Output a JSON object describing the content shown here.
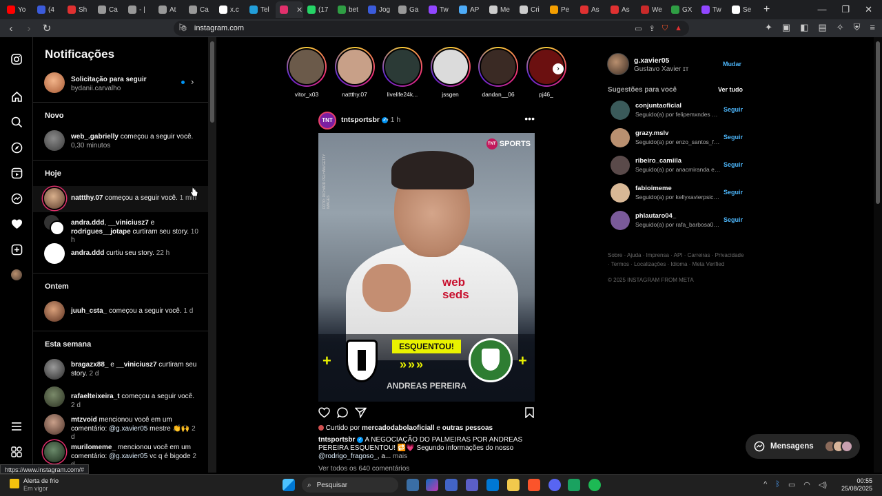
{
  "browser": {
    "tabs": [
      {
        "label": "Yo",
        "color": "#ff0000"
      },
      {
        "label": "(4",
        "color": "#3b5bdb"
      },
      {
        "label": "Sh",
        "color": "#e03131"
      },
      {
        "label": "Ca",
        "color": "#999999"
      },
      {
        "label": "- |",
        "color": "#999999"
      },
      {
        "label": "At",
        "color": "#999999"
      },
      {
        "label": "Ca",
        "color": "#999999"
      },
      {
        "label": "x.c",
        "color": "#ffffff"
      },
      {
        "label": "Tel",
        "color": "#229ed9"
      },
      {
        "label": "",
        "color": "#e1306c"
      },
      {
        "label": "(17",
        "color": "#25d366"
      },
      {
        "label": "bet",
        "color": "#2f9e44"
      },
      {
        "label": "Jog",
        "color": "#3b5bdb"
      },
      {
        "label": "Ga",
        "color": "#999999"
      },
      {
        "label": "Tw",
        "color": "#9146ff"
      },
      {
        "label": "AP",
        "color": "#4dabf7"
      },
      {
        "label": "Me",
        "color": "#cccccc"
      },
      {
        "label": "Cri",
        "color": "#cccccc"
      },
      {
        "label": "Pe",
        "color": "#f59f00"
      },
      {
        "label": "As",
        "color": "#e03131"
      },
      {
        "label": "As",
        "color": "#e03131"
      },
      {
        "label": "We",
        "color": "#c92a2a"
      },
      {
        "label": "GX",
        "color": "#2f9e44"
      },
      {
        "label": "Tw",
        "color": "#9146ff"
      },
      {
        "label": "Se",
        "color": "#ffffff"
      }
    ],
    "url": "instagram.com",
    "status_url": "https://www.instagram.com/#"
  },
  "notifications": {
    "title": "Notificações",
    "follow_request": {
      "title": "Solicitação para seguir",
      "user": "bydanii.carvalho"
    },
    "sections": {
      "novo": "Novo",
      "hoje": "Hoje",
      "ontem": "Ontem",
      "semana": "Esta semana"
    },
    "items": [
      {
        "user": "web_.gabrielly",
        "text": " começou a seguir você.",
        "time": " 0,30 minutos"
      },
      {
        "user": "nattthy.07",
        "text": " começou a seguir você.",
        "time": " 1 min"
      },
      {
        "user": "andra.ddd",
        "user2": "__viniciusz7",
        "user3": "rodrigues__jotape",
        "text": " curtiram seu story.",
        "time": " 10 h",
        "joiner": ", ",
        "joiner2": " e "
      },
      {
        "user": "andra.ddd",
        "text": " curtiu seu story.",
        "time": " 22 h"
      },
      {
        "user": "juuh_csta_",
        "text": " começou a seguir você.",
        "time": " 1 d"
      },
      {
        "user": "bragazx88_",
        "user2": "__viniciusz7",
        "text": " curtiram seu story.",
        "time": " 2 d",
        "joiner": " e "
      },
      {
        "user": "rafaelteixeira_t",
        "text": " começou a seguir você.",
        "time": " 2 d"
      },
      {
        "user": "mtzvoid",
        "text": " mencionou você em um comentário: ",
        "mention": "@g.xavier05",
        "text2": " mestre 👏🙌",
        "time": " 2 d"
      },
      {
        "user": "murilomeme_",
        "text": " mencionou você em um comentário: ",
        "mention": "@g.xavier05",
        "text2": " vc q é bigode",
        "time": " 2 d"
      }
    ]
  },
  "stories": [
    {
      "name": "vitor_x03",
      "color": "#6b5a4a"
    },
    {
      "name": "nattthy.07",
      "color": "#c8a088"
    },
    {
      "name": "livelife24k...",
      "color": "#2b3a36"
    },
    {
      "name": "jssgen",
      "color": "#dbdbdb"
    },
    {
      "name": "dandan__06",
      "color": "#3a2a24"
    },
    {
      "name": "pj46_",
      "color": "#6b1010"
    }
  ],
  "post": {
    "avatar_text": "TNT",
    "user": "tntsportsbr",
    "time": "• 1 h",
    "brand": "SPORTS",
    "sponsor_line1": "web",
    "sponsor_line2": "seds",
    "banner": "ESQUENTOU!",
    "arrows": "»»»",
    "plus": "+",
    "player": "ANDREAS PEREIRA",
    "side_credit": "FOTO: RICHARD PELHAM/GETTY IMAGES",
    "liked_prefix": "Curtido por ",
    "liked_user": "mercadodabolaoficiall",
    "liked_suffix": " e ",
    "liked_others": "outras pessoas",
    "caption_text": " A NEGOCIAÇÃO DO PALMEIRAS POR ANDREAS PEREIRA ESQUENTOU! 🔁💗 Segundo informações do nosso ",
    "caption_mention": "@rodrigo_fragoso_",
    "caption_end": ", a...",
    "more": " mais",
    "comments": "Ver todos os 640 comentários"
  },
  "sidebar_right": {
    "username": "g.xavier05",
    "fullname": "Gustavo Xavier ɪᴛ",
    "switch": "Mudar",
    "suggestions_title": "Sugestões para você",
    "see_all": "Ver tudo",
    "follow_label": "Seguir",
    "suggestions": [
      {
        "user": "conjuntaoficial",
        "sub": "Seguido(a) por felipemxndes e ...",
        "color": "#3a5a5a"
      },
      {
        "user": "grazy.mslv",
        "sub": "Seguido(a) por enzo_santos_fra...",
        "color": "#b99070"
      },
      {
        "user": "ribeiro_camiila",
        "sub": "Seguido(a) por anacmiranda e ...",
        "color": "#5a4a4a"
      },
      {
        "user": "fabioimeme",
        "sub": "Seguido(a) por kellyxavierpsican...",
        "color": "#d8b896"
      },
      {
        "user": "phlautaro04_",
        "sub": "Seguido(a) por rafa_barbosa06 ...",
        "color": "#7a5a9a"
      }
    ],
    "footer": "Sobre · Ajuda · Imprensa · API · Carreiras · Privacidade · Termos · Localizações · Idioma · Meta Verified",
    "copyright": "© 2025 INSTAGRAM FROM META"
  },
  "messages": {
    "label": "Mensagens"
  },
  "taskbar": {
    "weather_title": "Alerta de frio",
    "weather_sub": "Em vigor",
    "search_placeholder": "Pesquisar",
    "time": "00:55",
    "date": "25/08/2025"
  }
}
